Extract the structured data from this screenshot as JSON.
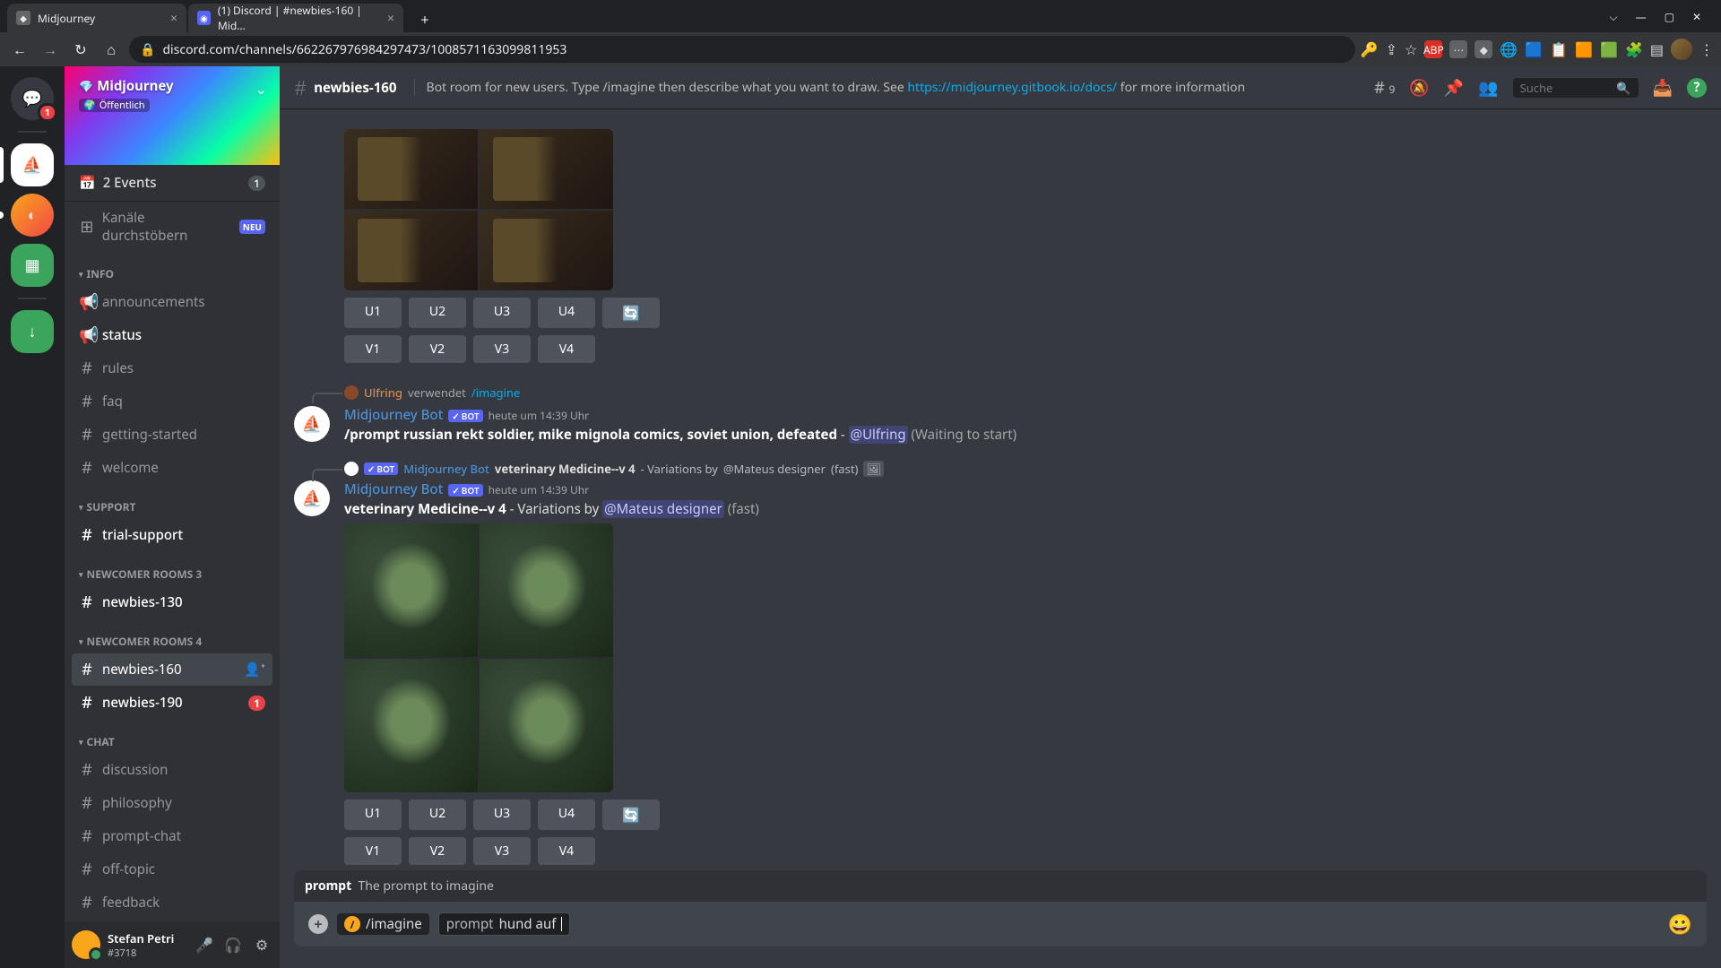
{
  "browser": {
    "tabs": [
      {
        "title": "Midjourney",
        "active": false
      },
      {
        "title": "(1) Discord | #newbies-160 | Mid…",
        "active": true
      }
    ],
    "url": "discord.com/channels/662267976984297473/1008571163099811953",
    "window_controls": {
      "dropdown": "⌵",
      "minimize": "—",
      "maximize": "▢",
      "close": "✕"
    }
  },
  "server": {
    "name": "Midjourney",
    "visibility": "Öffentlich",
    "events_label": "2 Events",
    "events_count": "1",
    "browse_label": "Kanäle durchstöbern",
    "neu_badge": "NEU"
  },
  "sections": {
    "info": {
      "label": "INFO",
      "channels": [
        {
          "name": "announcements"
        },
        {
          "name": "status",
          "bold": true
        },
        {
          "name": "rules"
        },
        {
          "name": "faq"
        },
        {
          "name": "getting-started"
        },
        {
          "name": "welcome"
        }
      ]
    },
    "support": {
      "label": "SUPPORT",
      "channels": [
        {
          "name": "trial-support",
          "bold": true
        }
      ]
    },
    "nc3": {
      "label": "NEWCOMER ROOMS 3",
      "channels": [
        {
          "name": "newbies-130",
          "bold": true
        }
      ]
    },
    "nc4": {
      "label": "NEWCOMER ROOMS 4",
      "channels": [
        {
          "name": "newbies-160",
          "active": true
        },
        {
          "name": "newbies-190",
          "bold": true,
          "badge": "1"
        }
      ]
    },
    "chat": {
      "label": "CHAT",
      "channels": [
        {
          "name": "discussion"
        },
        {
          "name": "philosophy"
        },
        {
          "name": "prompt-chat"
        },
        {
          "name": "off-topic"
        },
        {
          "name": "feedback"
        }
      ]
    }
  },
  "user_panel": {
    "name": "Stefan Petri",
    "disc": "#3718"
  },
  "header": {
    "channel": "newbies-160",
    "topic_prefix": "Bot room for new users. Type /imagine then describe what you want to draw. See ",
    "topic_link": "https://midjourney.gitbook.io/docs/",
    "topic_suffix": " for more information",
    "thread_count": "9",
    "search_placeholder": "Suche"
  },
  "buttons": {
    "u": [
      "U1",
      "U2",
      "U3",
      "U4"
    ],
    "v": [
      "V1",
      "V2",
      "V3",
      "V4"
    ]
  },
  "messages": {
    "m1": {
      "interaction_user": "Ulfring",
      "interaction_verb": "verwendet",
      "interaction_cmd": "/imagine",
      "author": "Midjourney Bot",
      "timestamp": "heute um 14:39 Uhr",
      "prompt_label": "/prompt",
      "prompt_text": "russian rekt soldier, mike mignola comics, soviet union, defeated",
      "dash": " - ",
      "mention": "@Ulfring",
      "status": "(Waiting to start)"
    },
    "m2": {
      "reply_author": "Midjourney Bot",
      "reply_ref1": "veterinary Medicine--v 4",
      "reply_mid": " - Variations by ",
      "reply_mention": "@Mateus designer",
      "reply_status": "(fast)",
      "author": "Midjourney Bot",
      "timestamp": "heute um 14:39 Uhr",
      "body_strong": "veterinary Medicine--v 4",
      "body_mid": " - Variations by ",
      "body_mention": "@Mateus designer",
      "body_status": "(fast)"
    }
  },
  "input": {
    "autocomplete_label": "prompt",
    "autocomplete_desc": "The prompt to imagine",
    "command": "/imagine",
    "param_name": "prompt",
    "param_value": "hund auf"
  },
  "bot_tag": "BOT"
}
